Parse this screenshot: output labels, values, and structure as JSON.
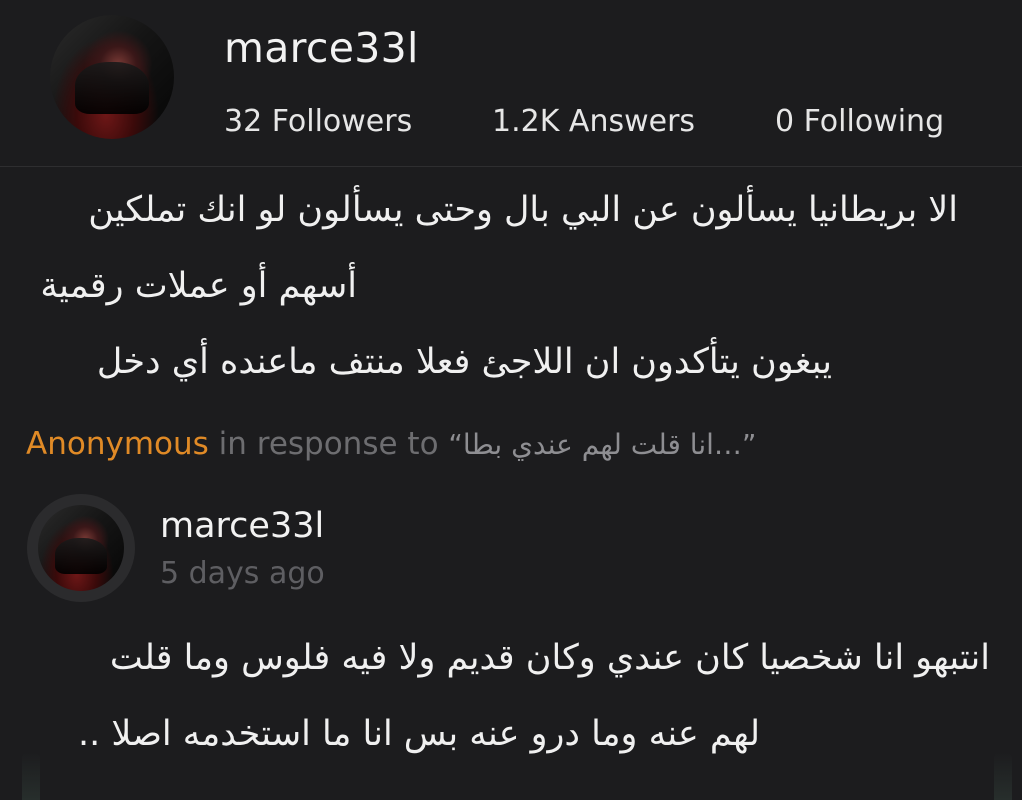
{
  "profile": {
    "username": "marce33l",
    "followers": "32 Followers",
    "answers": "1.2K Answers",
    "following": "0 Following"
  },
  "question": {
    "lines": [
      "الا بريطانيا يسألون عن البي بال وحتى يسألون لو انك تملكين",
      "أسهم أو عملات رقمية",
      "يبغون يتأكدون ان اللاجئ فعلا منتف ماعنده أي دخل"
    ],
    "asker": "Anonymous",
    "in_response_to": "in response to",
    "quoted": "“انا قلت لهم عندي بطا…”"
  },
  "answer": {
    "author": "marce33l",
    "time": "5 days ago",
    "lines": [
      "انتبهو انا شخصيا كان عندي وكان قديم ولا فيه فلوس وما قلت",
      "لهم عنه وما درو عنه بس انا ما استخدمه اصلا .."
    ]
  }
}
